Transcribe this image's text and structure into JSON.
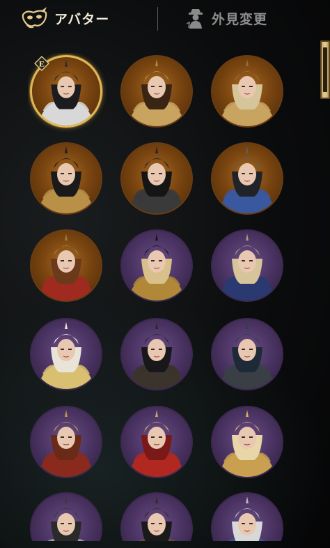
{
  "header": {
    "tabs": [
      {
        "label": "アバター",
        "icon": "mask-icon",
        "active": true
      },
      {
        "label": "外見変更",
        "icon": "character-icon",
        "active": false
      }
    ]
  },
  "badge": {
    "letter": "E"
  },
  "avatars": [
    {
      "frame": "gold",
      "selected": true,
      "hair": "#1c1c20",
      "armor": "#d8d8d8",
      "helm": "#2a2a30"
    },
    {
      "frame": "gold",
      "selected": false,
      "hair": "#3a2414",
      "armor": "#c8a460",
      "helm": "#b08a40"
    },
    {
      "frame": "gold",
      "selected": false,
      "hair": "#d6c49a",
      "armor": "#c8a460",
      "helm": "#8a7238"
    },
    {
      "frame": "gold",
      "selected": false,
      "hair": "#1a1a1a",
      "armor": "#b89048",
      "helm": "#1e1e22"
    },
    {
      "frame": "gold",
      "selected": false,
      "hair": "#151515",
      "armor": "#3a3a3a",
      "helm": "#25252a"
    },
    {
      "frame": "gold",
      "selected": false,
      "hair": "#202428",
      "armor": "#3a58a0",
      "helm": "#5a5e66"
    },
    {
      "frame": "gold",
      "selected": false,
      "hair": "#6a3a1a",
      "armor": "#a02a20",
      "helm": "#9a7a3a"
    },
    {
      "frame": "purple",
      "selected": false,
      "hair": "#d8c08a",
      "armor": "#b08838",
      "helm": "#18181a"
    },
    {
      "frame": "purple",
      "selected": false,
      "hair": "#d6c49a",
      "armor": "#2a3a70",
      "helm": "#a89a7a"
    },
    {
      "frame": "purple",
      "selected": false,
      "hair": "#e8e4d8",
      "armor": "#d8c070",
      "helm": "#ece8dc"
    },
    {
      "frame": "purple",
      "selected": false,
      "hair": "#18181a",
      "armor": "#3a342c",
      "helm": "#2a2a2a"
    },
    {
      "frame": "purple",
      "selected": false,
      "hair": "#1e2a38",
      "armor": "#3a3f46",
      "helm": "#30404a"
    },
    {
      "frame": "purple",
      "selected": false,
      "hair": "#6a2a18",
      "armor": "#8a2a1c",
      "helm": "#b89a40"
    },
    {
      "frame": "purple",
      "selected": false,
      "hair": "#7a1a18",
      "armor": "#b02820",
      "helm": "#c8a868"
    },
    {
      "frame": "purple",
      "selected": false,
      "hair": "#e8d6a8",
      "armor": "#c8a050",
      "helm": "#d0b060"
    },
    {
      "frame": "purple",
      "selected": false,
      "hair": "#2a2a2a",
      "armor": "#a8a8a8",
      "helm": "#3a3a3a"
    },
    {
      "frame": "purple",
      "selected": false,
      "hair": "#1a1a1a",
      "armor": "#6a5230",
      "helm": "#3a2a20"
    },
    {
      "frame": "purple",
      "selected": false,
      "hair": "#d8d8d8",
      "armor": "#3a5aa8",
      "helm": "#b8b8b8"
    }
  ],
  "colors": {
    "tab_active": "#f3ead8",
    "tab_inactive": "#8f8f8f",
    "selected_ring": "#e0b85a",
    "gold_frame": "#7a4510",
    "purple_frame": "#4a3362"
  }
}
